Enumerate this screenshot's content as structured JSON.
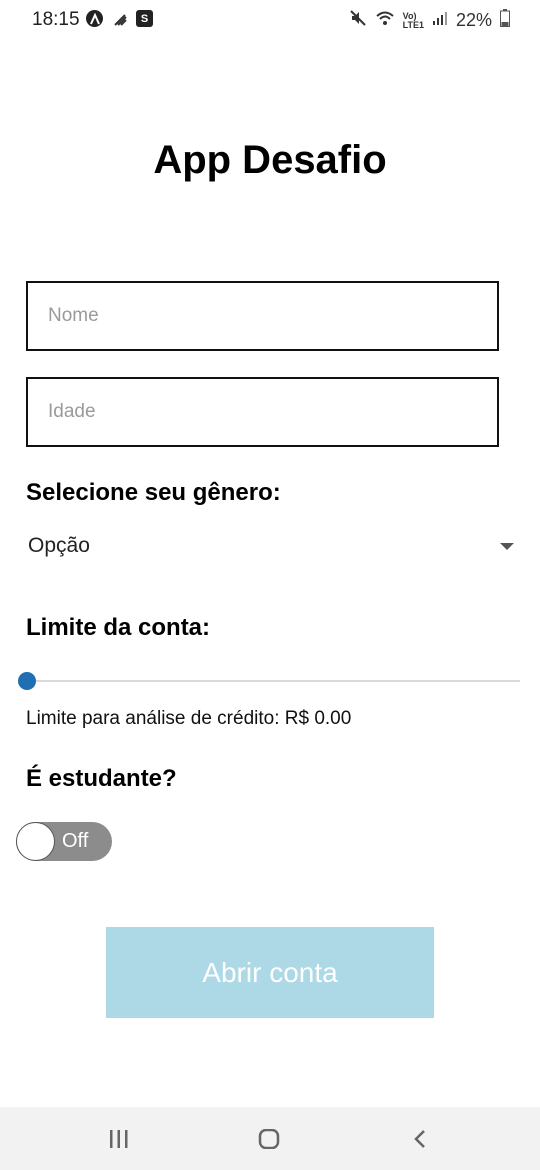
{
  "status_bar": {
    "time": "18:15",
    "battery_text": "22%",
    "network_small_top": "Vo)",
    "network_small_bottom": "LTE1"
  },
  "app": {
    "title": "App Desafio"
  },
  "form": {
    "name_placeholder": "Nome",
    "age_placeholder": "Idade",
    "gender_label": "Selecione seu gênero:",
    "gender_selected": "Opção",
    "limit_label": "Limite da conta:",
    "limit_value": 0,
    "limit_text": "Limite para análise de crédito: R$ 0.00",
    "student_label": "É estudante?",
    "student_toggle_text": "Off",
    "submit_label": "Abrir conta"
  },
  "colors": {
    "slider_thumb": "#1f6fb2",
    "toggle_track": "#8c8c8c",
    "button_bg": "#add8e6"
  },
  "icons": {
    "status_left": [
      "app-icon",
      "signal-bars-icon",
      "s-app-icon"
    ],
    "status_right": [
      "mute-icon",
      "wifi-icon",
      "signal-icon",
      "battery-icon"
    ],
    "nav": [
      "recent-apps-icon",
      "home-icon",
      "back-icon"
    ]
  }
}
